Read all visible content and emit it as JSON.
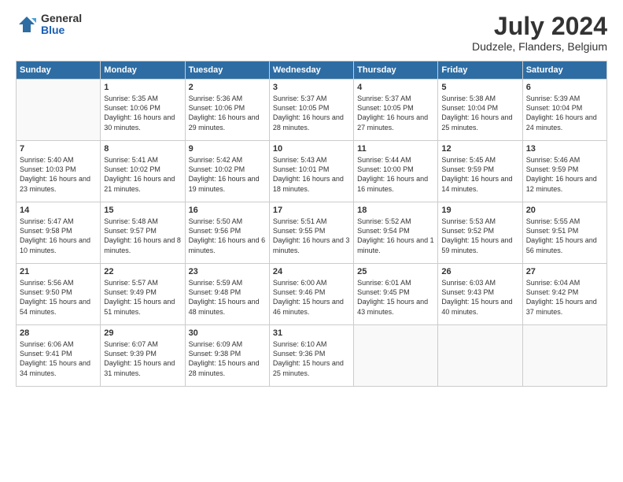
{
  "logo": {
    "general": "General",
    "blue": "Blue"
  },
  "title": "July 2024",
  "subtitle": "Dudzele, Flanders, Belgium",
  "headers": [
    "Sunday",
    "Monday",
    "Tuesday",
    "Wednesday",
    "Thursday",
    "Friday",
    "Saturday"
  ],
  "weeks": [
    [
      {
        "day": "",
        "info": ""
      },
      {
        "day": "1",
        "info": "Sunrise: 5:35 AM\nSunset: 10:06 PM\nDaylight: 16 hours\nand 30 minutes."
      },
      {
        "day": "2",
        "info": "Sunrise: 5:36 AM\nSunset: 10:06 PM\nDaylight: 16 hours\nand 29 minutes."
      },
      {
        "day": "3",
        "info": "Sunrise: 5:37 AM\nSunset: 10:05 PM\nDaylight: 16 hours\nand 28 minutes."
      },
      {
        "day": "4",
        "info": "Sunrise: 5:37 AM\nSunset: 10:05 PM\nDaylight: 16 hours\nand 27 minutes."
      },
      {
        "day": "5",
        "info": "Sunrise: 5:38 AM\nSunset: 10:04 PM\nDaylight: 16 hours\nand 25 minutes."
      },
      {
        "day": "6",
        "info": "Sunrise: 5:39 AM\nSunset: 10:04 PM\nDaylight: 16 hours\nand 24 minutes."
      }
    ],
    [
      {
        "day": "7",
        "info": "Sunrise: 5:40 AM\nSunset: 10:03 PM\nDaylight: 16 hours\nand 23 minutes."
      },
      {
        "day": "8",
        "info": "Sunrise: 5:41 AM\nSunset: 10:02 PM\nDaylight: 16 hours\nand 21 minutes."
      },
      {
        "day": "9",
        "info": "Sunrise: 5:42 AM\nSunset: 10:02 PM\nDaylight: 16 hours\nand 19 minutes."
      },
      {
        "day": "10",
        "info": "Sunrise: 5:43 AM\nSunset: 10:01 PM\nDaylight: 16 hours\nand 18 minutes."
      },
      {
        "day": "11",
        "info": "Sunrise: 5:44 AM\nSunset: 10:00 PM\nDaylight: 16 hours\nand 16 minutes."
      },
      {
        "day": "12",
        "info": "Sunrise: 5:45 AM\nSunset: 9:59 PM\nDaylight: 16 hours\nand 14 minutes."
      },
      {
        "day": "13",
        "info": "Sunrise: 5:46 AM\nSunset: 9:59 PM\nDaylight: 16 hours\nand 12 minutes."
      }
    ],
    [
      {
        "day": "14",
        "info": "Sunrise: 5:47 AM\nSunset: 9:58 PM\nDaylight: 16 hours\nand 10 minutes."
      },
      {
        "day": "15",
        "info": "Sunrise: 5:48 AM\nSunset: 9:57 PM\nDaylight: 16 hours\nand 8 minutes."
      },
      {
        "day": "16",
        "info": "Sunrise: 5:50 AM\nSunset: 9:56 PM\nDaylight: 16 hours\nand 6 minutes."
      },
      {
        "day": "17",
        "info": "Sunrise: 5:51 AM\nSunset: 9:55 PM\nDaylight: 16 hours\nand 3 minutes."
      },
      {
        "day": "18",
        "info": "Sunrise: 5:52 AM\nSunset: 9:54 PM\nDaylight: 16 hours\nand 1 minute."
      },
      {
        "day": "19",
        "info": "Sunrise: 5:53 AM\nSunset: 9:52 PM\nDaylight: 15 hours\nand 59 minutes."
      },
      {
        "day": "20",
        "info": "Sunrise: 5:55 AM\nSunset: 9:51 PM\nDaylight: 15 hours\nand 56 minutes."
      }
    ],
    [
      {
        "day": "21",
        "info": "Sunrise: 5:56 AM\nSunset: 9:50 PM\nDaylight: 15 hours\nand 54 minutes."
      },
      {
        "day": "22",
        "info": "Sunrise: 5:57 AM\nSunset: 9:49 PM\nDaylight: 15 hours\nand 51 minutes."
      },
      {
        "day": "23",
        "info": "Sunrise: 5:59 AM\nSunset: 9:48 PM\nDaylight: 15 hours\nand 48 minutes."
      },
      {
        "day": "24",
        "info": "Sunrise: 6:00 AM\nSunset: 9:46 PM\nDaylight: 15 hours\nand 46 minutes."
      },
      {
        "day": "25",
        "info": "Sunrise: 6:01 AM\nSunset: 9:45 PM\nDaylight: 15 hours\nand 43 minutes."
      },
      {
        "day": "26",
        "info": "Sunrise: 6:03 AM\nSunset: 9:43 PM\nDaylight: 15 hours\nand 40 minutes."
      },
      {
        "day": "27",
        "info": "Sunrise: 6:04 AM\nSunset: 9:42 PM\nDaylight: 15 hours\nand 37 minutes."
      }
    ],
    [
      {
        "day": "28",
        "info": "Sunrise: 6:06 AM\nSunset: 9:41 PM\nDaylight: 15 hours\nand 34 minutes."
      },
      {
        "day": "29",
        "info": "Sunrise: 6:07 AM\nSunset: 9:39 PM\nDaylight: 15 hours\nand 31 minutes."
      },
      {
        "day": "30",
        "info": "Sunrise: 6:09 AM\nSunset: 9:38 PM\nDaylight: 15 hours\nand 28 minutes."
      },
      {
        "day": "31",
        "info": "Sunrise: 6:10 AM\nSunset: 9:36 PM\nDaylight: 15 hours\nand 25 minutes."
      },
      {
        "day": "",
        "info": ""
      },
      {
        "day": "",
        "info": ""
      },
      {
        "day": "",
        "info": ""
      }
    ]
  ]
}
